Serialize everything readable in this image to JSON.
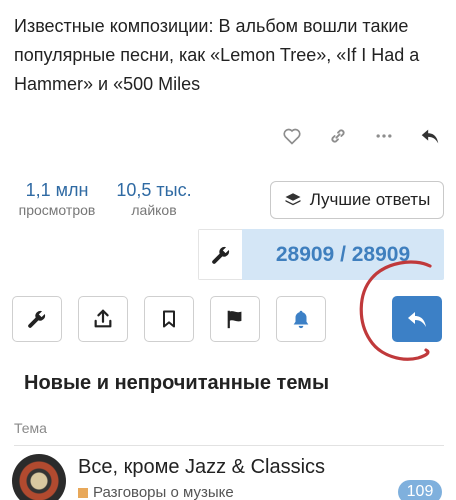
{
  "post": {
    "text": "Известные композиции: В альбом вошли такие популярные песни, как «Lemon Tree», «If I Had a Hammer» и «500 Miles"
  },
  "stats": {
    "views_value": "1,1 млн",
    "views_label": "просмотров",
    "likes_value": "10,5 тыс.",
    "likes_label": "лайков"
  },
  "best_answers_label": "Лучшие ответы",
  "progress": {
    "current": 28909,
    "total": 28909,
    "text": "28909 / 28909"
  },
  "section": {
    "title": "Новые и непрочитанные темы",
    "column_header": "Тема"
  },
  "topic": {
    "title": "Все, кроме Jazz & Classics",
    "category": "Разговоры о музыке",
    "category_color": "#e8a85a",
    "count": "109"
  },
  "colors": {
    "accent": "#3c80c6",
    "link": "#2f6aa3",
    "annotation": "#c0393b"
  },
  "icons": {
    "post_actions": [
      "heart-icon",
      "link-icon",
      "more-icon",
      "reply-icon"
    ],
    "toolbar": [
      "wrench-icon",
      "share-icon",
      "bookmark-icon",
      "flag-icon",
      "bell-icon",
      "reply-icon"
    ]
  }
}
